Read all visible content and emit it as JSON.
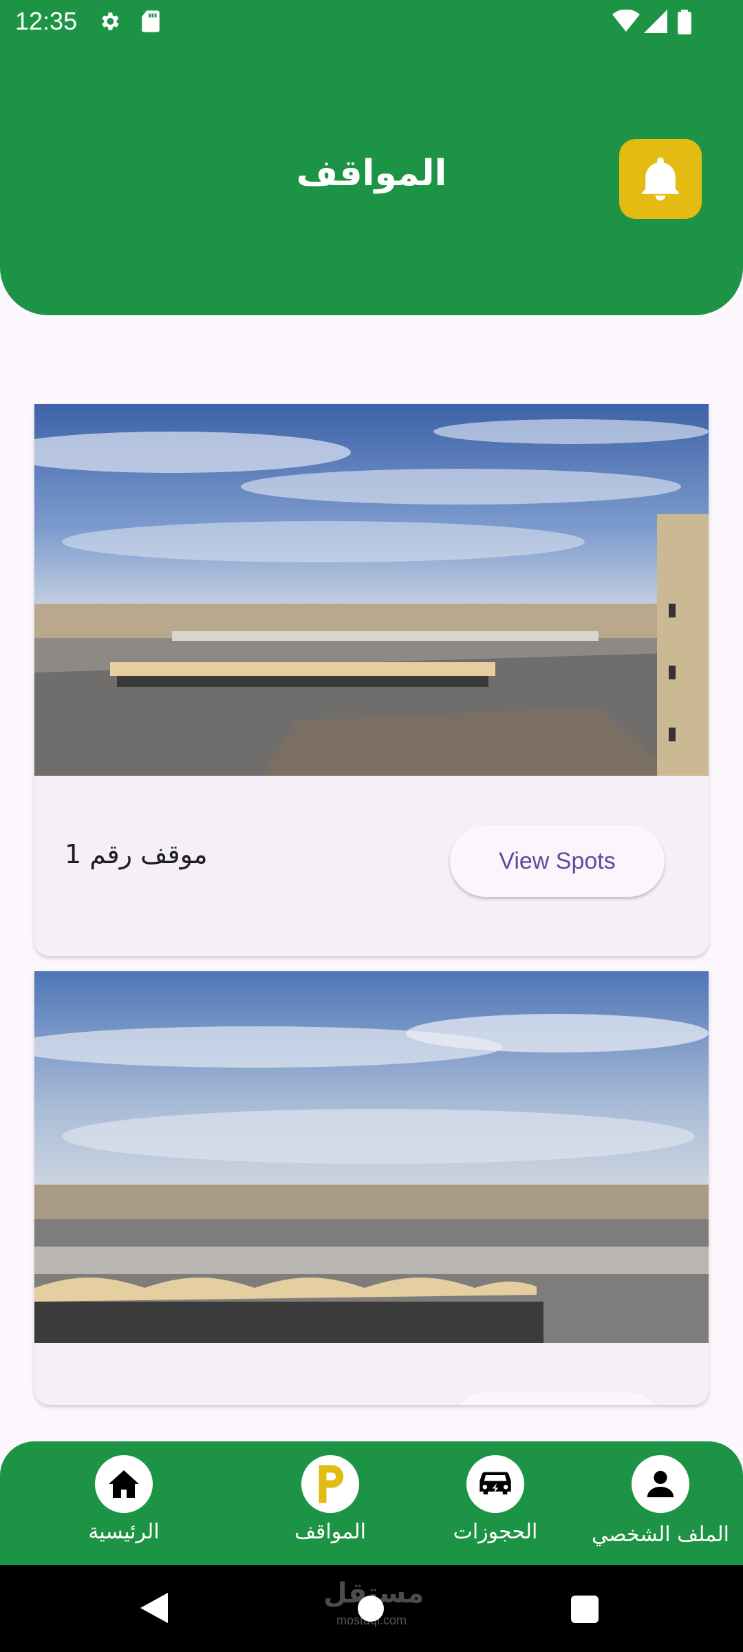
{
  "status_bar": {
    "time": "12:35"
  },
  "header": {
    "title": "المواقف"
  },
  "cards": [
    {
      "label": "موقف رقم 1",
      "button": "View Spots"
    },
    {
      "label": "",
      "button": ""
    }
  ],
  "bottom_nav": {
    "items": [
      {
        "label": "الرئيسية",
        "icon": "home-icon"
      },
      {
        "label": "المواقف",
        "icon": "parking-icon"
      },
      {
        "label": "الحجوزات",
        "icon": "car-icon"
      },
      {
        "label": "الملف الشخصي",
        "icon": "person-icon"
      }
    ]
  },
  "watermark": {
    "text": "مستقل",
    "sub": "mostaql.com"
  },
  "colors": {
    "primary": "#1d9445",
    "bell": "#e3bb12",
    "accent_text": "#5b4c9a"
  }
}
